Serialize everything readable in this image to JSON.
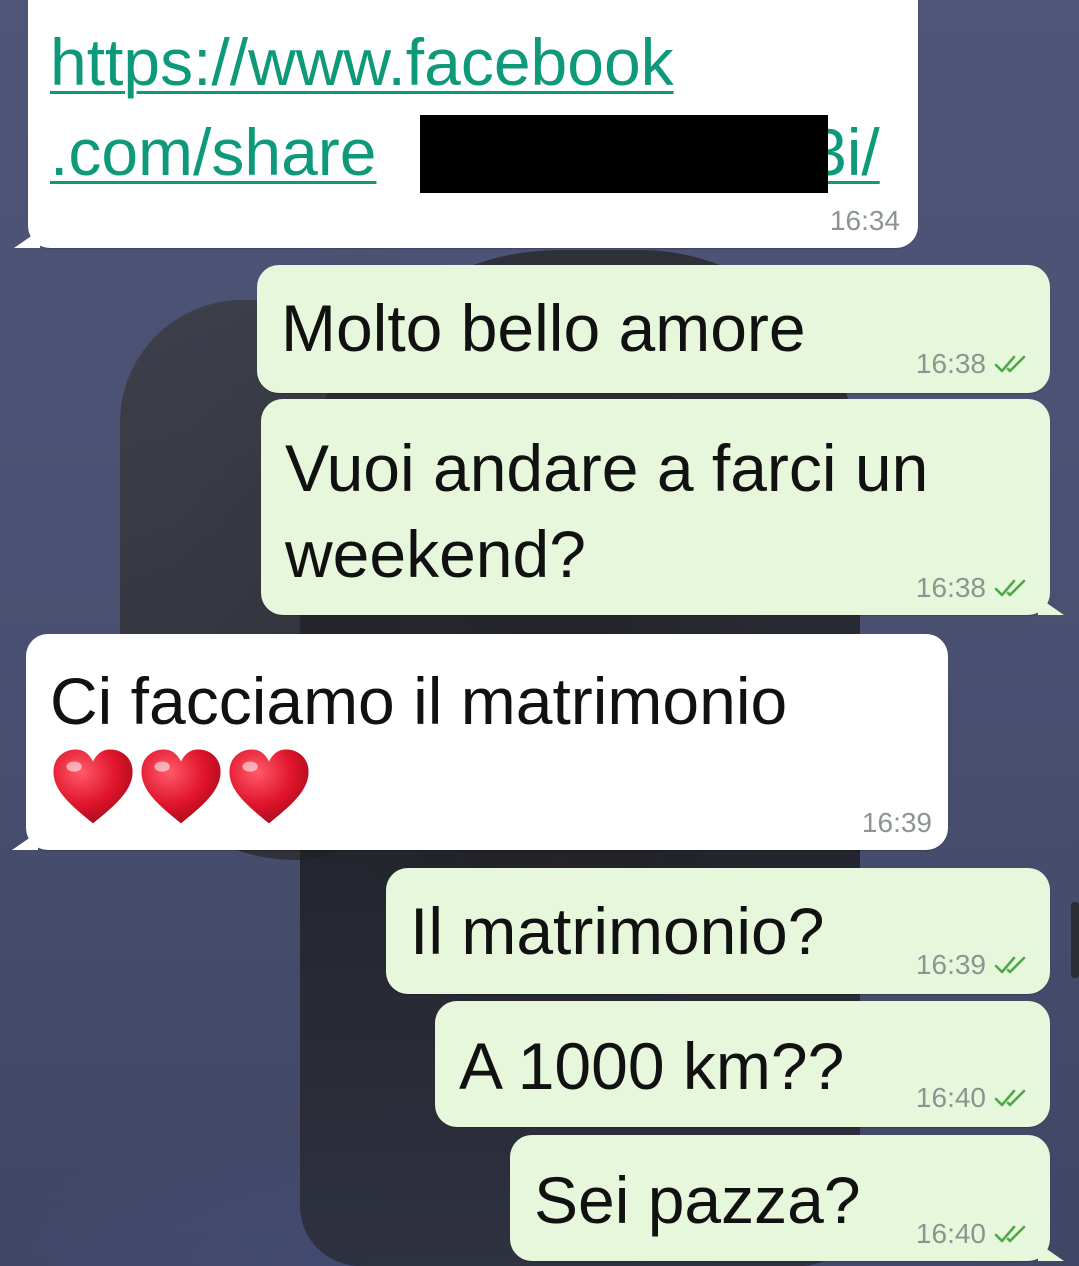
{
  "chat": {
    "messages": [
      {
        "direction": "in",
        "link_line1": "https://www.facebook",
        "link_line2_start": ".com/share",
        "link_line2_end": "3i/",
        "time": "16:34",
        "redacted": true
      },
      {
        "direction": "out",
        "text": "Molto bello amore",
        "time": "16:38",
        "status": "read"
      },
      {
        "direction": "out",
        "line1": "Vuoi andare a farci un",
        "line2": "weekend?",
        "time": "16:38",
        "status": "read"
      },
      {
        "direction": "in",
        "line1": "Ci facciamo il matrimonio",
        "emoji": "❤️❤️❤️",
        "emoji_icon": "red-heart-icon",
        "time": "16:39"
      },
      {
        "direction": "out",
        "text": "Il matrimonio?",
        "time": "16:39",
        "status": "read"
      },
      {
        "direction": "out",
        "text": "A 1000 km??",
        "time": "16:40",
        "status": "read"
      },
      {
        "direction": "out",
        "text": "Sei pazza?",
        "time": "16:40",
        "status": "read"
      }
    ]
  },
  "colors": {
    "incoming_bubble": "#ffffff",
    "outgoing_bubble": "#e6f7dc",
    "link": "#0e9a7a",
    "meta_text": "#8c9491",
    "read_ticks": "#4fa84a",
    "heart": "#e0142b"
  },
  "icons": {
    "read_receipt": "double-check-icon"
  }
}
